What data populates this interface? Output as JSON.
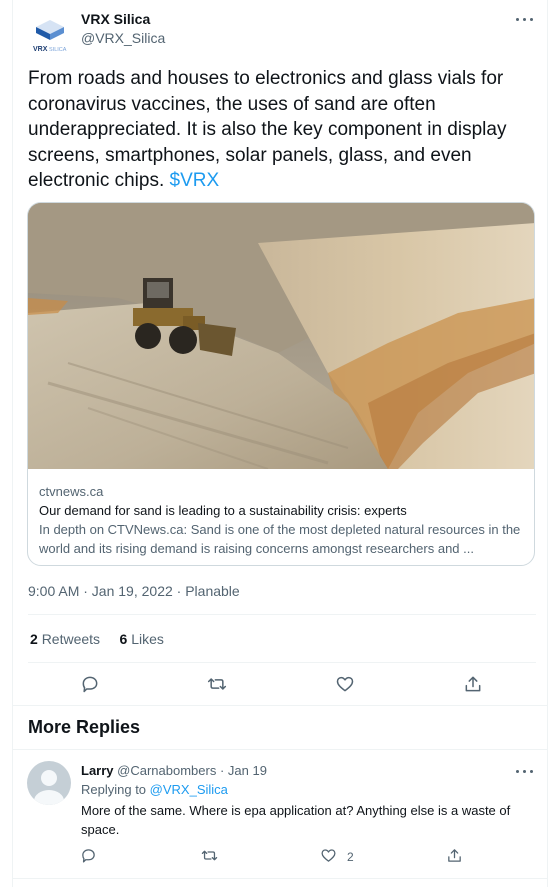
{
  "tweet": {
    "author_name": "VRX Silica",
    "author_handle": "@VRX_Silica",
    "logo_text": "VRX",
    "logo_subtext": "SILICA",
    "text": "From roads and houses to electronics and glass vials for coronavirus vaccines, the uses of sand are often underappreciated. It is also the key component in display screens, smartphones, solar panels, glass, and even electronic chips. ",
    "cashtag": "$VRX",
    "card": {
      "domain": "ctvnews.ca",
      "title": "Our demand for sand is leading to a sustainability crisis: experts",
      "description": "In depth on CTVNews.ca: Sand is one of the most depleted natural resources in the world and its rising demand is raising concerns amongst researchers and ..."
    },
    "timestamp": "9:00 AM · Jan 19, 2022 · Planable",
    "retweets_count": "2",
    "retweets_label": "Retweets",
    "likes_count": "6",
    "likes_label": "Likes"
  },
  "replies_section": {
    "heading": "More Replies"
  },
  "reply": {
    "name": "Larry",
    "handle_date": "@Carnabombers · Jan 19",
    "replying_prefix": "Replying to ",
    "replying_handle": "@VRX_Silica",
    "text": "More of the same. Where is epa application at? Anything else is a waste of space.",
    "like_count": "2"
  },
  "colors": {
    "link": "#1d9bf0",
    "secondary_text": "#536471",
    "border": "#cfd9de",
    "logo_blue": "#1f5aa8"
  }
}
